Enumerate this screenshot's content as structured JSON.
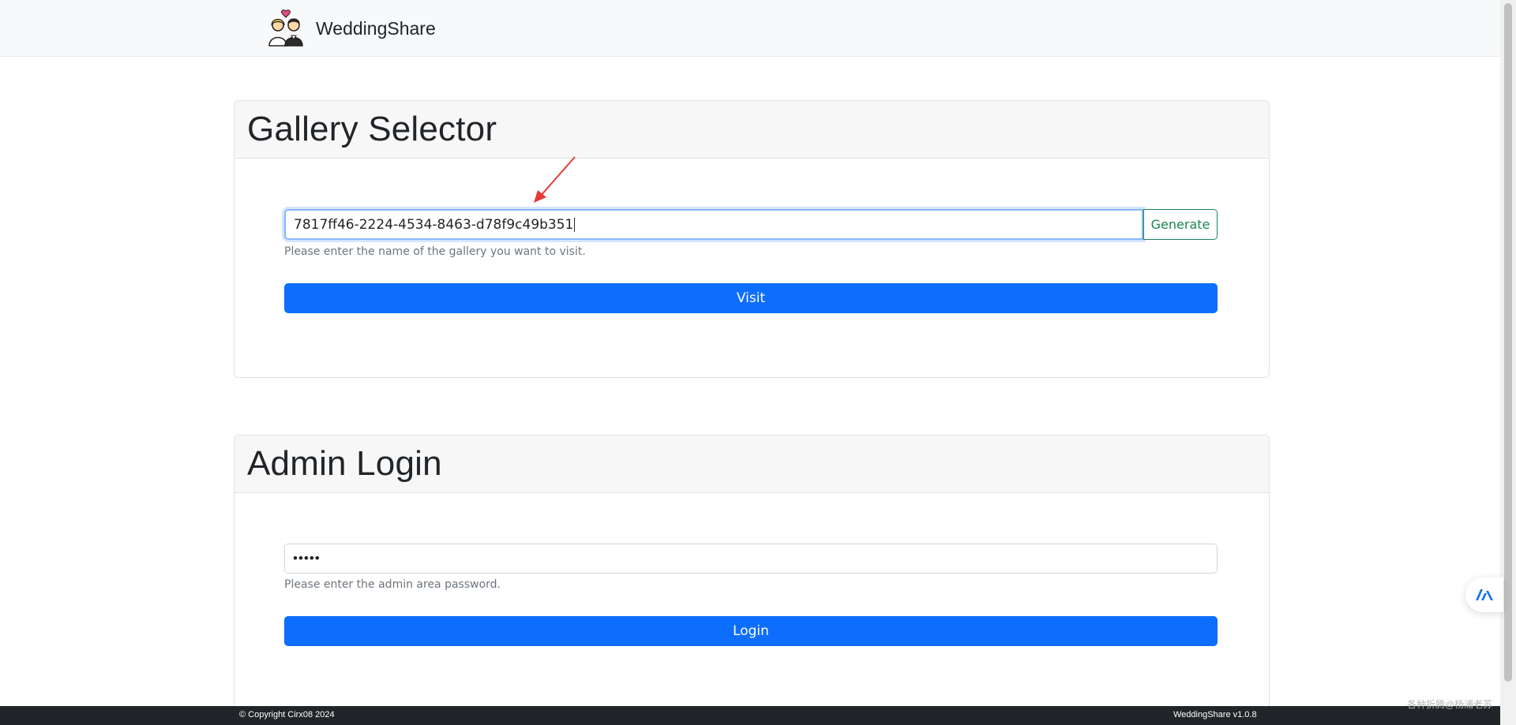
{
  "navbar": {
    "brand": "WeddingShare",
    "logo_icon": "wedding-couple-icon"
  },
  "gallery_selector": {
    "title": "Gallery Selector",
    "input_value": "7817ff46-2224-4534-8463-d78f9c49b351",
    "generate_label": "Generate",
    "help": "Please enter the name of the gallery you want to visit.",
    "visit_label": "Visit"
  },
  "admin_login": {
    "title": "Admin Login",
    "password_mask": "•••••",
    "help": "Please enter the admin area password.",
    "login_label": "Login"
  },
  "footer": {
    "copyright": "© Copyright Cirx08 2024",
    "version": "WeddingShare v1.0.8"
  },
  "overlay": {
    "watermark": "各种折腾@杨浦老苏",
    "float_icon": "assistant-logo-icon"
  },
  "colors": {
    "primary": "#0d6efd",
    "success": "#198754",
    "footer_bg": "#212529",
    "annotation": "#e53935"
  }
}
